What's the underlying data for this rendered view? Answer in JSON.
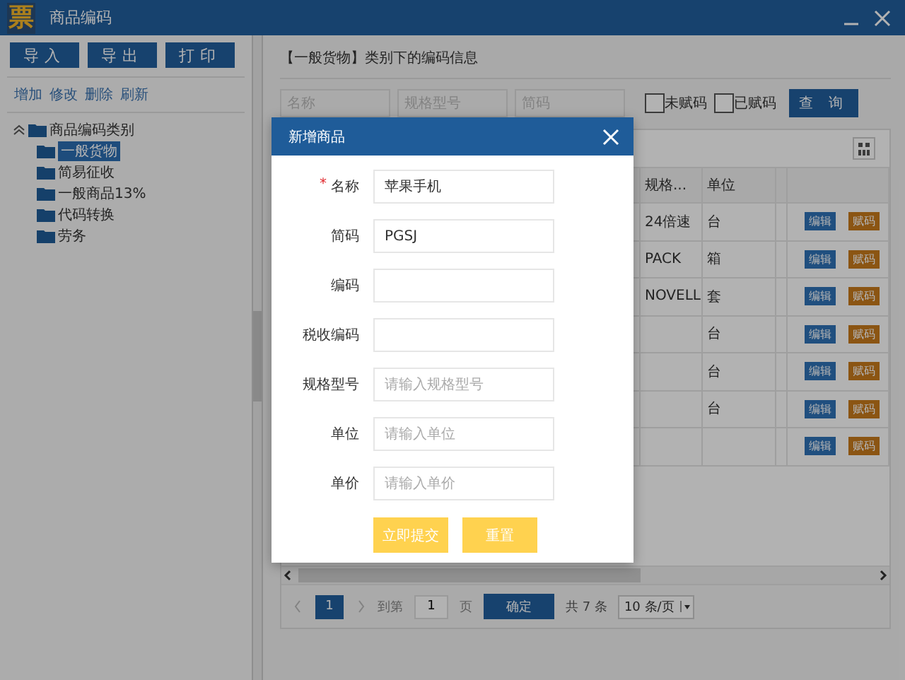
{
  "window": {
    "logo": "票",
    "title": "商品编码"
  },
  "toolbar": [
    "导入",
    "导出",
    "打印"
  ],
  "actions": [
    "增加",
    "修改",
    "删除",
    "刷新"
  ],
  "tree": {
    "label": "商品编码类别",
    "expanded": true,
    "children": [
      {
        "label": "一般货物",
        "selected": true
      },
      {
        "label": "简易征收",
        "selected": false
      },
      {
        "label": "一般商品13%",
        "selected": false
      },
      {
        "label": "代码转换",
        "selected": false
      },
      {
        "label": "劳务",
        "selected": false
      }
    ]
  },
  "heading": "【一般货物】类别下的编码信息",
  "filters": {
    "fields": [
      {
        "placeholder": "名称"
      },
      {
        "placeholder": "规格型号"
      },
      {
        "placeholder": "简码"
      }
    ],
    "checkboxes": [
      {
        "label": "未赋码",
        "checked": false
      },
      {
        "label": "已赋码",
        "checked": false
      }
    ],
    "button": "查 询"
  },
  "table": {
    "columns": [
      "规格...",
      "单位"
    ],
    "rows": [
      {
        "spec": "24倍速",
        "unit": "台",
        "actions": [
          "编辑",
          "赋码"
        ]
      },
      {
        "spec": "PACK",
        "unit": "箱",
        "actions": [
          "编辑",
          "赋码"
        ]
      },
      {
        "spec": "NOVELL",
        "unit": "套",
        "actions": [
          "编辑",
          "赋码"
        ]
      },
      {
        "spec": "",
        "unit": "台",
        "actions": [
          "编辑",
          "赋码"
        ]
      },
      {
        "spec": "",
        "unit": "台",
        "actions": [
          "编辑",
          "赋码"
        ]
      },
      {
        "spec": "",
        "unit": "台",
        "actions": [
          "编辑",
          "赋码"
        ]
      },
      {
        "spec": "",
        "unit": "",
        "actions": [
          "编辑",
          "赋码"
        ]
      }
    ]
  },
  "pager": {
    "pages": [
      {
        "label": "1",
        "selected": true
      }
    ],
    "goto_label": "到第",
    "goto_value": "1",
    "page_unit": "页",
    "confirm": "确定",
    "total": "共 7 条",
    "page_size": "10 条/页"
  },
  "dialog": {
    "title": "新增商品",
    "required_mark": "*",
    "fields": [
      {
        "label": "名称",
        "required": true,
        "value": "苹果手机"
      },
      {
        "label": "简码",
        "required": false,
        "value": "PGSJ"
      },
      {
        "label": "编码",
        "required": false
      },
      {
        "label": "税收编码",
        "required": false
      },
      {
        "label": "规格型号",
        "required": false,
        "placeholder": "请输入规格型号"
      },
      {
        "label": "单位",
        "required": false,
        "placeholder": "请输入单位"
      },
      {
        "label": "单价",
        "required": false,
        "placeholder": "请输入单价"
      }
    ],
    "buttons": [
      "立即提交",
      "重置"
    ]
  }
}
